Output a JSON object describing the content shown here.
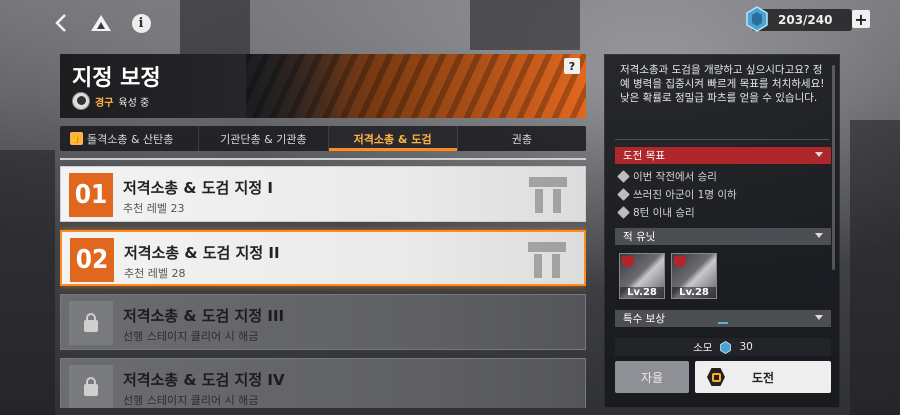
{
  "topbar": {
    "back_icon": "chevron-left-icon",
    "drive_icon": "triangle-logo-icon",
    "info_icon": "info-icon",
    "stamina": "203/240",
    "plus": "+"
  },
  "header": {
    "title": "지정 보정",
    "role_highlight": "경구",
    "role_rest": "육성 중",
    "help": "?"
  },
  "tabs": [
    {
      "label": "돌격소총 & 산탄총",
      "active": false
    },
    {
      "label": "기관단총 & 기관총",
      "active": false
    },
    {
      "label": "저격소총 & 도검",
      "active": true
    },
    {
      "label": "권총",
      "active": false
    }
  ],
  "stages": [
    {
      "num": "01",
      "name": "저격소총 & 도검 지정 I",
      "sub": "추천 레벨 23",
      "locked": false,
      "selected": false
    },
    {
      "num": "02",
      "name": "저격소총 & 도검 지정 II",
      "sub": "추천 레벨 28",
      "locked": false,
      "selected": true
    },
    {
      "num": "",
      "name": "저격소총 & 도검 지정 III",
      "sub": "선행 스테이지 클리어 시 해금",
      "locked": true,
      "selected": false
    },
    {
      "num": "",
      "name": "저격소총 & 도검 지정 IV",
      "sub": "선행 스테이지 클리어 시 해금",
      "locked": true,
      "selected": false
    }
  ],
  "panel": {
    "description": "저격소총과 도검을 개량하고 싶으시다고요? 정예 병력을 집중시켜 빠르게 목표를 처치하세요! 낮은 확률로 정밀급 파츠를 얻을 수 있습니다.",
    "objectives_title": "도전 목표",
    "objectives": [
      "이번 작전에서 승리",
      "쓰러진 아군이 1명 이하",
      "8턴 이내 승리"
    ],
    "enemies_title": "적 유닛",
    "enemies": [
      {
        "level": "Lv.28"
      },
      {
        "level": "Lv.28"
      }
    ],
    "rewards_title": "특수 보상",
    "cost_label": "소모",
    "cost_value": "30",
    "auto_label": "자율",
    "challenge_label": "도전"
  },
  "colors": {
    "accent_orange": "#e2671e",
    "objective_red": "#b0272b",
    "active_tab_text": "#ffb347"
  }
}
